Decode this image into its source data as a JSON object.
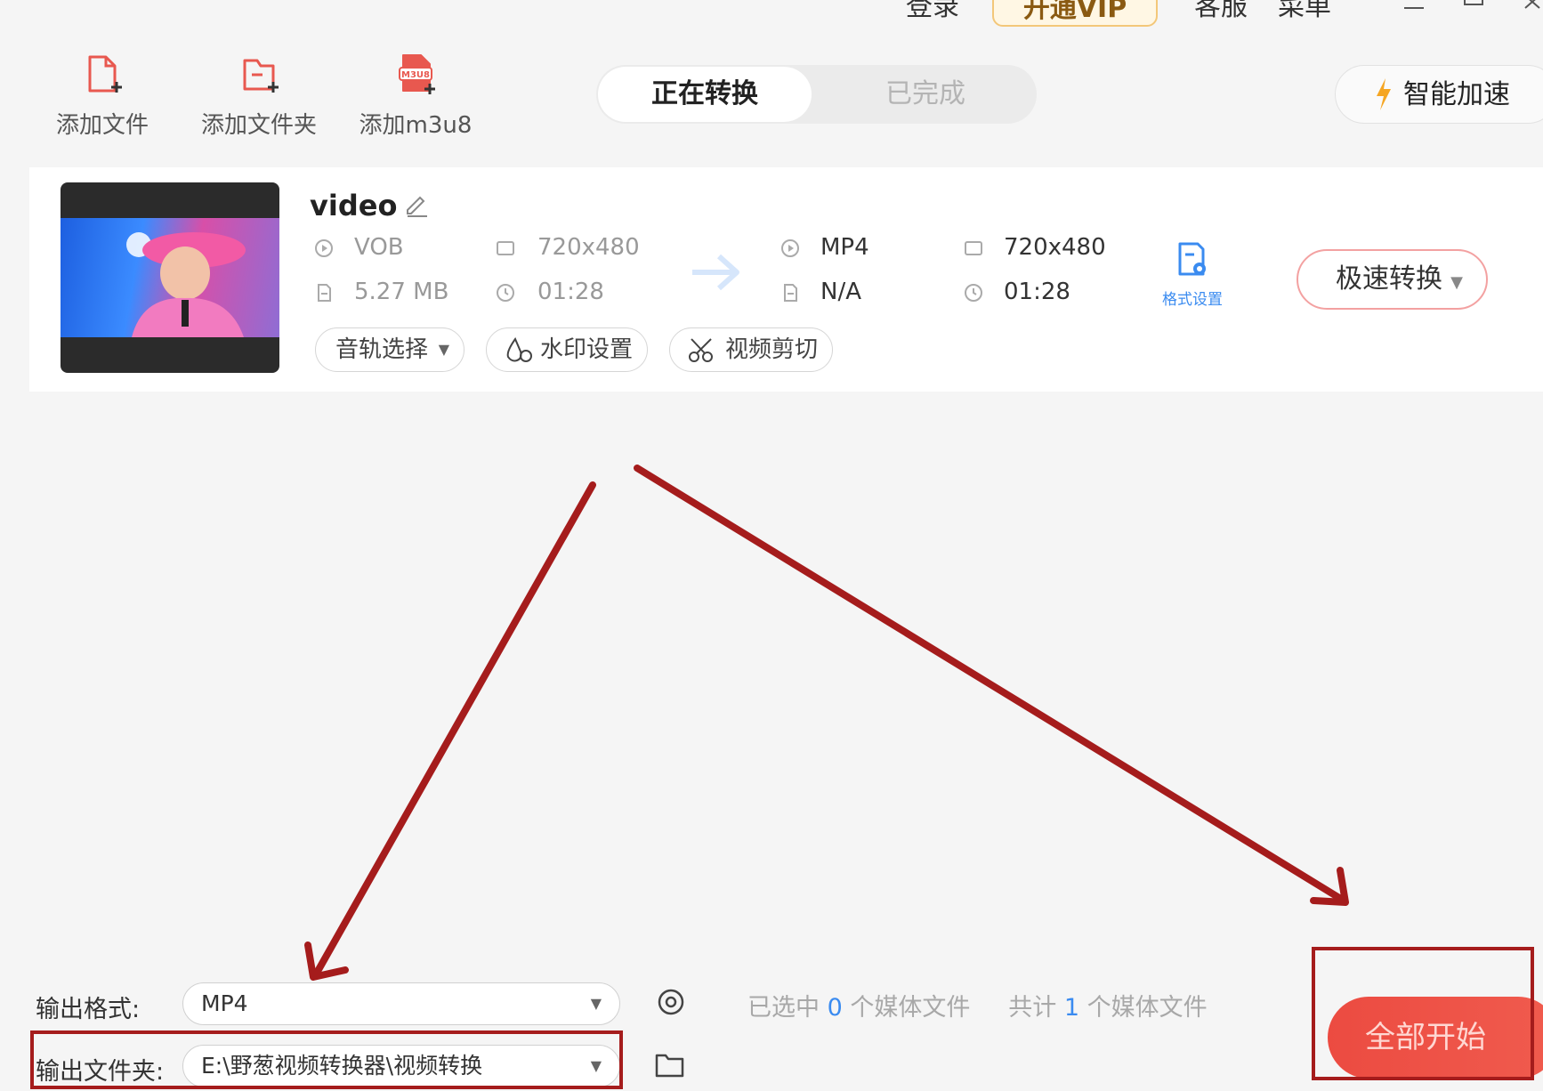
{
  "titlebar": {
    "login": "登录",
    "vip": "开通VIP",
    "service": "客服",
    "menu": "菜单"
  },
  "toolbar": {
    "add_file": "添加文件",
    "add_folder": "添加文件夹",
    "add_m3u8": "添加m3u8",
    "m3u8_badge": "M3U8"
  },
  "tabs": {
    "converting": "正在转换",
    "done": "已完成"
  },
  "accel": "智能加速",
  "file": {
    "name": "video",
    "source": {
      "format": "VOB",
      "resolution": "720x480",
      "size": "5.27 MB",
      "duration": "01:28"
    },
    "target": {
      "format": "MP4",
      "resolution": "720x480",
      "size": "N/A",
      "duration": "01:28"
    },
    "format_settings": "格式设置",
    "fast_convert": "极速转换",
    "audio_track": "音轨选择",
    "watermark": "水印设置",
    "clip": "视频剪切"
  },
  "bottom": {
    "output_format_label": "输出格式:",
    "output_format_value": "MP4",
    "output_folder_label": "输出文件夹:",
    "output_folder_value": "E:\\野葱视频转换器\\视频转换",
    "selected_prefix": "已选中",
    "selected_count": "0",
    "selected_suffix": "个媒体文件",
    "total_prefix": "共计",
    "total_count": "1",
    "total_suffix": "个媒体文件",
    "start_all": "全部开始"
  },
  "colors": {
    "accent_red": "#ec4b41",
    "link_blue": "#3a8bf0",
    "annotation": "#a51c1c"
  }
}
